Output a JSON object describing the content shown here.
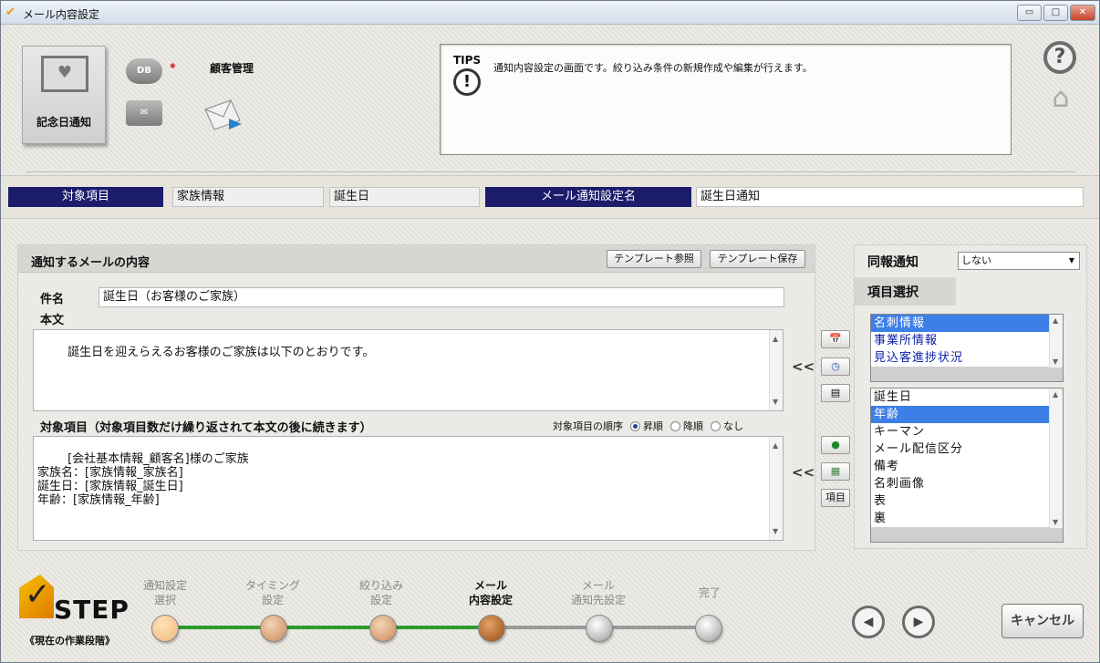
{
  "window": {
    "title": "メール内容設定"
  },
  "header": {
    "big_tile_label": "記念日通知",
    "db_label": "DB",
    "db_caption": "顧客管理",
    "tips_title": "TIPS",
    "tips_text": "通知内容設定の画面です。絞り込み条件の新規作成や編集が行えます。"
  },
  "info": {
    "target_label": "対象項目",
    "target_value1": "家族情報",
    "target_value2": "誕生日",
    "setting_label": "メール通知設定名",
    "setting_value": "誕生日通知"
  },
  "mail": {
    "section_title": "通知するメールの内容",
    "template_ref": "テンプレート参照",
    "template_save": "テンプレート保存",
    "subject_label": "件名",
    "subject_value": "誕生日（お客様のご家族）",
    "body_label": "本文",
    "body_value": "誕生日を迎えらえるお客様のご家族は以下のとおりです。",
    "items_label": "対象項目（対象項目数だけ繰り返されて本文の後に続きます）",
    "order_label": "対象項目の順序",
    "order_options": [
      "昇順",
      "降順",
      "なし"
    ],
    "items_value": "[会社基本情報_顧客名]様のご家族\n家族名：[家族情報_家族名]\n誕生日：[家族情報_誕生日]\n年齢：[家族情報_年齢]"
  },
  "tools": {
    "arrows": "<<",
    "item_button": "項目"
  },
  "side": {
    "notify_label": "同報通知",
    "notify_value": "しない",
    "select_label": "項目選択",
    "categories": [
      "名刺情報",
      "事業所情報",
      "見込客進捗状況"
    ],
    "fields": [
      "誕生日",
      "年齢",
      "キーマン",
      "メール配信区分",
      "備考",
      "名刺画像",
      "表",
      "裏"
    ]
  },
  "footer": {
    "step_word": "STEP",
    "step_caption": "《現在の作業段階》",
    "steps": [
      {
        "l1": "通知設定",
        "l2": "選択"
      },
      {
        "l1": "タイミング",
        "l2": "設定"
      },
      {
        "l1": "絞り込み",
        "l2": "設定"
      },
      {
        "l1": "メール",
        "l2": "内容設定"
      },
      {
        "l1": "メール",
        "l2": "通知先設定"
      },
      {
        "l1": "完了",
        "l2": ""
      }
    ],
    "prev": "◀",
    "next": "▶",
    "cancel": "キャンセル"
  },
  "colors": {
    "navy": "#1b1d6b",
    "selection": "#3d7fe6",
    "progress": "#2f9a2f"
  }
}
